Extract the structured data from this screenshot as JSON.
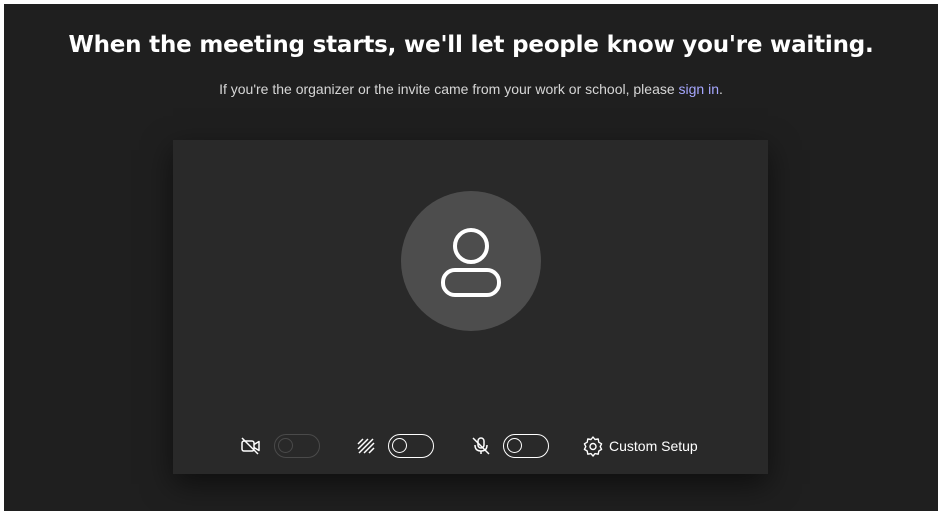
{
  "header": {
    "title": "When the meeting starts, we'll let people know you're waiting.",
    "subtitle_prefix": "If you're the organizer or the invite came from your work or school, please ",
    "signin_link": "sign in",
    "subtitle_suffix": "."
  },
  "preview": {
    "avatar_icon": "person-icon",
    "background": "#292929"
  },
  "controls": {
    "camera": {
      "icon": "camera-off-icon",
      "enabled": false,
      "on": false
    },
    "background_effects": {
      "icon": "background-blur-icon",
      "on": false
    },
    "microphone": {
      "icon": "mic-off-icon",
      "on": false
    },
    "custom_setup": {
      "icon": "gear-icon",
      "label": "Custom Setup"
    }
  },
  "colors": {
    "page_background": "#1f1f1f",
    "link": "#a6a7ff",
    "avatar": "#4d4d4d"
  }
}
